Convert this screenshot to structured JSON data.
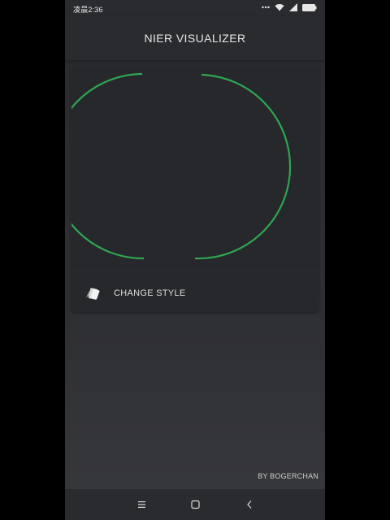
{
  "status_bar": {
    "time": "凌晨2:36",
    "icons": [
      "more-dots-icon",
      "wifi-icon",
      "signal-icon",
      "battery-icon"
    ]
  },
  "app_bar": {
    "title": "NIER VISUALIZER"
  },
  "visualizer": {
    "style": "arc-circle",
    "color": "#2fa552"
  },
  "actions": {
    "change_style_label": "CHANGE STYLE",
    "change_style_icon": "cards-icon"
  },
  "footer": {
    "credit": "BY BOGERCHAN"
  },
  "nav_bar": {
    "icons": [
      "menu-icon",
      "home-square-icon",
      "back-chevron-icon"
    ]
  },
  "colors": {
    "background": "#2e2f33",
    "card": "#27282c",
    "accent": "#2fa552",
    "text": "#e8e8e8"
  }
}
